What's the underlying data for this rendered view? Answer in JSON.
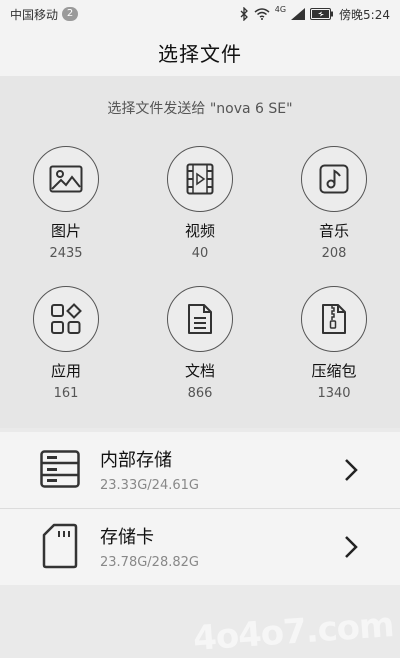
{
  "status": {
    "carrier": "中国移动",
    "notif_count": "2",
    "network": "4G",
    "time": "傍晚5:24"
  },
  "header": {
    "title": "选择文件"
  },
  "subtitle": "选择文件发送给 \"nova 6 SE\"",
  "categories": [
    {
      "label": "图片",
      "count": "2435",
      "icon": "image-icon"
    },
    {
      "label": "视频",
      "count": "40",
      "icon": "video-icon"
    },
    {
      "label": "音乐",
      "count": "208",
      "icon": "music-icon"
    },
    {
      "label": "应用",
      "count": "161",
      "icon": "apps-icon"
    },
    {
      "label": "文档",
      "count": "866",
      "icon": "document-icon"
    },
    {
      "label": "压缩包",
      "count": "1340",
      "icon": "archive-icon"
    }
  ],
  "storage": [
    {
      "name": "内部存储",
      "size": "23.33G/24.61G",
      "icon": "internal-storage-icon"
    },
    {
      "name": "存储卡",
      "size": "23.78G/28.82G",
      "icon": "sd-card-icon"
    }
  ],
  "watermark": "4o4o7.com"
}
